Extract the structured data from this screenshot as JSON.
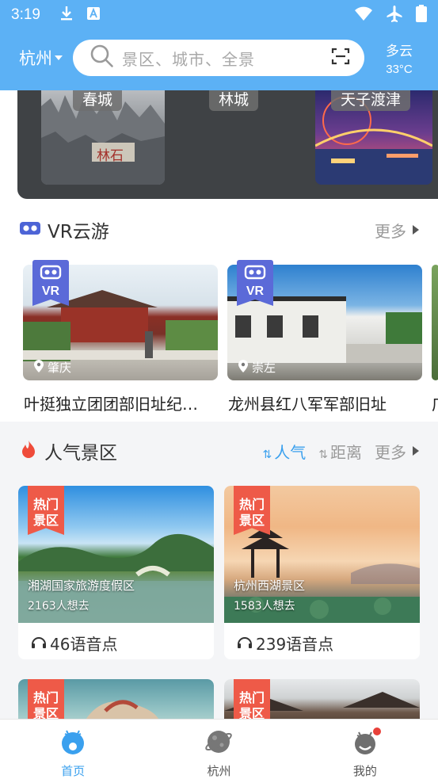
{
  "status_bar": {
    "time": "3:19"
  },
  "header": {
    "city": "杭州",
    "search_placeholder": "景区、城市、全景",
    "weather": {
      "condition": "多云",
      "temperature": "33°C"
    }
  },
  "banner": {
    "labels": [
      "春城",
      "林城",
      "天子渡津"
    ],
    "stone_text": "林石"
  },
  "vr_section": {
    "title": "VR云游",
    "more": "更多",
    "badge": "VR",
    "cards": [
      {
        "location": "肇庆",
        "name": "叶挺独立团团部旧址纪…"
      },
      {
        "location": "崇左",
        "name": "龙州县红八军军部旧址"
      },
      {
        "name": "广"
      }
    ]
  },
  "popular_section": {
    "title": "人气景区",
    "sort_popular": "人气",
    "sort_distance": "距离",
    "more": "更多",
    "hot_badge": "热门景区",
    "cards": [
      {
        "name": "湘湖国家旅游度假区",
        "want": "2163人想去",
        "audio": "46语音点"
      },
      {
        "name": "杭州西湖景区",
        "want": "1583人想去",
        "audio": "239语音点"
      },
      {
        "name": ""
      },
      {
        "name": ""
      }
    ]
  },
  "nav": {
    "items": [
      "首页",
      "杭州",
      "我的"
    ]
  },
  "colors": {
    "header_blue": "#5cb1f5",
    "accent": "#3aa0ee",
    "vr_badge": "#5b6ad8",
    "hot_badge": "#ee5a48",
    "notify_dot": "#e8413a"
  }
}
